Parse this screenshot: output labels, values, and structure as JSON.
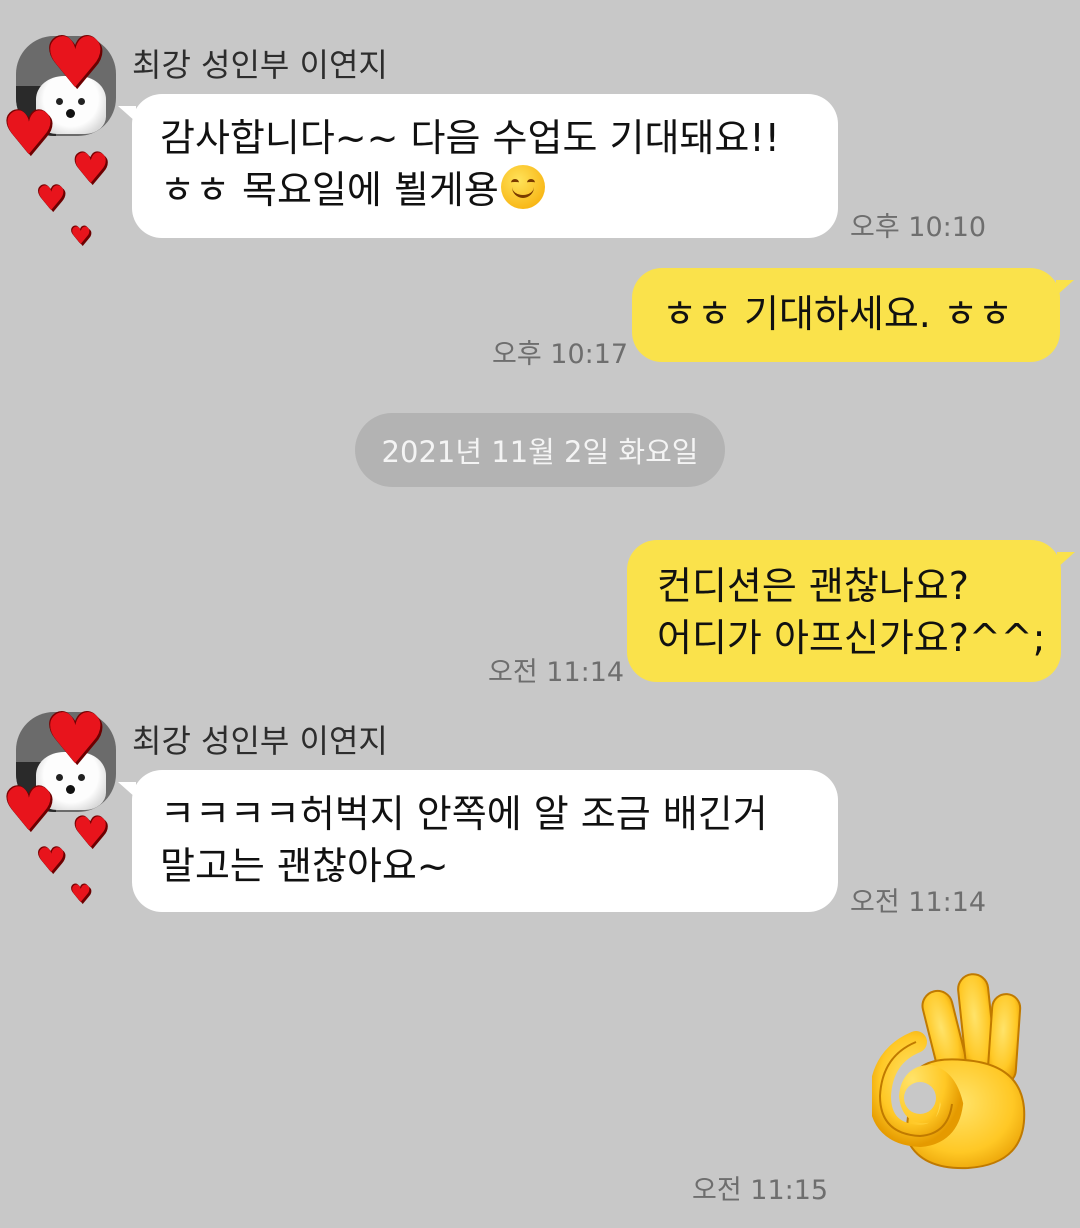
{
  "messages": [
    {
      "sender_name": "최강 성인부 이연지",
      "lines": [
        "감사합니다~~ 다음 수업도 기대돼요!!",
        "ㅎㅎ 목요일에 뵐게용"
      ],
      "emoji": "smiling-face",
      "time": "오후 10:10"
    },
    {
      "lines": [
        "ㅎㅎ 기대하세요. ㅎㅎ"
      ],
      "time": "오후 10:17"
    },
    {
      "lines": [
        "컨디션은 괜찮나요?",
        "어디가 아프신가요?^^;"
      ],
      "time": "오전 11:14"
    },
    {
      "sender_name": "최강 성인부 이연지",
      "lines": [
        "ㅋㅋㅋㅋ허벅지 안쪽에 알 조금 배긴거",
        "말고는 괜찮아요~"
      ],
      "time": "오전 11:14"
    },
    {
      "sticker": "ok-hand",
      "time": "오전 11:15"
    }
  ],
  "date_divider": "2021년 11월 2일 화요일",
  "colors": {
    "background": "#c8c8c8",
    "incoming_bubble": "#ffffff",
    "outgoing_bubble": "#fae24b",
    "date_pill": "#b3b3b3",
    "heart": "#e8141c"
  }
}
